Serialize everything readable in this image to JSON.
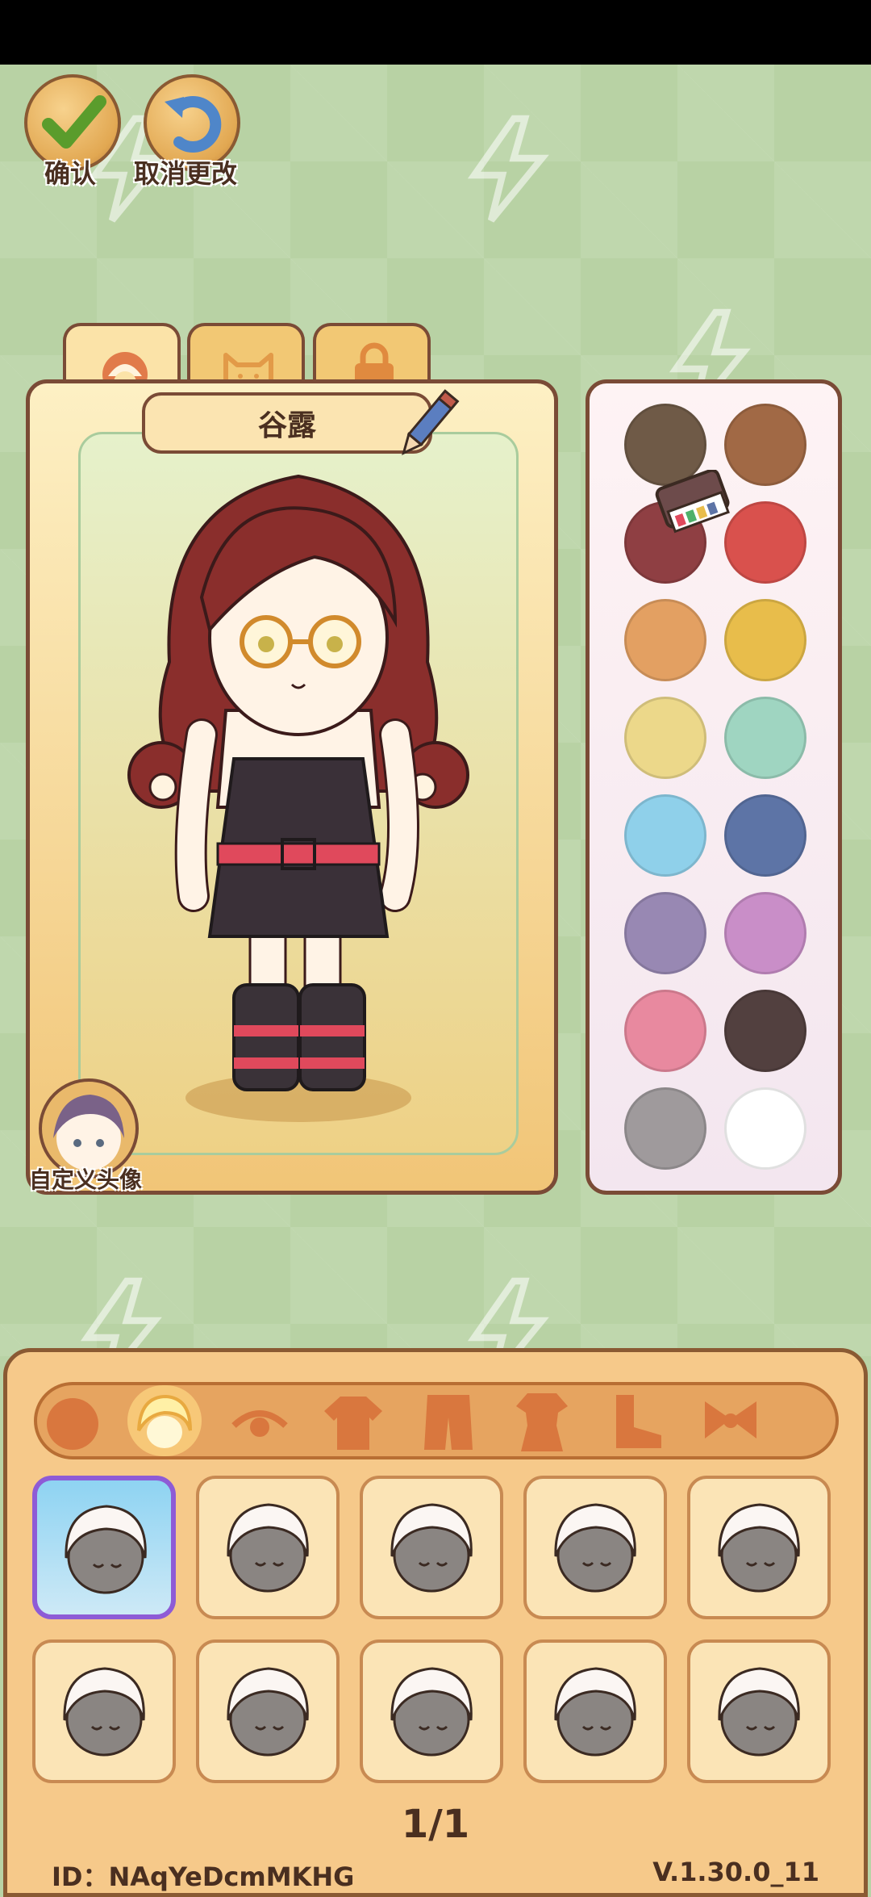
{
  "top": {
    "confirm_label": "确认",
    "cancel_label": "取消更改"
  },
  "character": {
    "name": "谷露",
    "avatar_label": "自定义头像",
    "tabs": [
      "face-icon",
      "cat-icon",
      "lock-icon"
    ]
  },
  "palette": {
    "colors": [
      "#6f5a47",
      "#a16945",
      "#8f3f43",
      "#d9514d",
      "#e3a062",
      "#e8bd4b",
      "#ecd88a",
      "#9fd5c1",
      "#8fd0ea",
      "#5d74a6",
      "#9888b3",
      "#c98ec8",
      "#e8899f",
      "#52403f",
      "#9f9a9c",
      "#ffffff"
    ]
  },
  "categories": [
    "body-icon",
    "hair-icon",
    "eyes-icon",
    "top-icon",
    "coat-icon",
    "outfit-icon",
    "shoes-icon",
    "bow-icon"
  ],
  "items": {
    "hairstyles": [
      "hair-1",
      "hair-2",
      "hair-3",
      "hair-4",
      "hair-5",
      "hair-6",
      "hair-7",
      "hair-8",
      "hair-9",
      "hair-10"
    ]
  },
  "pager": "1/1",
  "footer": {
    "id": "ID：NAqYeDcmMKHG",
    "version": "V.1.30.0_11"
  }
}
